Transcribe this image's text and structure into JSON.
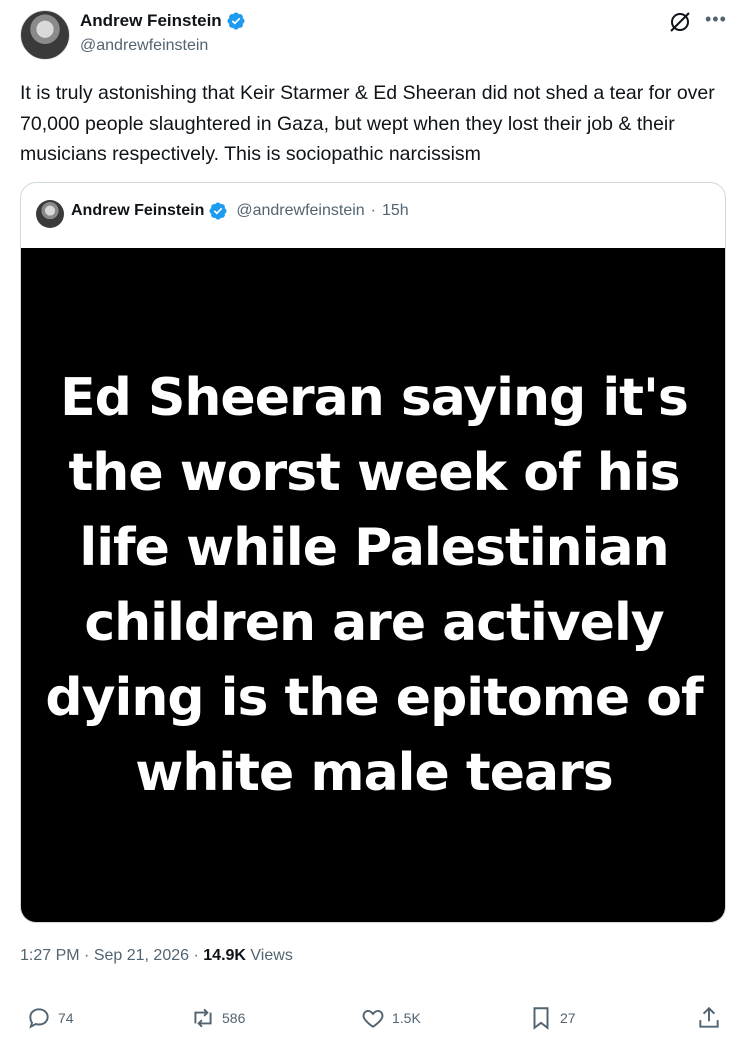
{
  "author": {
    "name": "Andrew Feinstein",
    "handle": "@andrewfeinstein"
  },
  "tweet_text": "It is truly astonishing that Keir Starmer & Ed Sheeran did not shed a tear for over 70,000 people slaughtered in Gaza, but wept when they lost their job & their musicians respectively. This is sociopathic narcissism",
  "quoted": {
    "name": "Andrew Feinstein",
    "handle": "@andrewfeinstein",
    "sep": "·",
    "time": "15h",
    "image_text": "Ed Sheeran saying it's the worst week of his life while Palestinian children are actively dying is the epitome of white male tears"
  },
  "meta": {
    "time": "1:27 PM",
    "sep1": "·",
    "date": "Sep 21, 2026",
    "sep2": "·",
    "views_count": "14.9K",
    "views_label": "Views"
  },
  "actions": {
    "reply": "74",
    "repost": "586",
    "like": "1.5K",
    "bookmark": "27"
  },
  "colors": {
    "verified": "#1d9bf0",
    "text": "#0f1419",
    "muted": "#536471",
    "border": "#cfd9de"
  },
  "icons": [
    "verified-badge-icon",
    "grok-icon",
    "more-icon",
    "reply-icon",
    "repost-icon",
    "like-icon",
    "bookmark-icon",
    "share-icon"
  ]
}
